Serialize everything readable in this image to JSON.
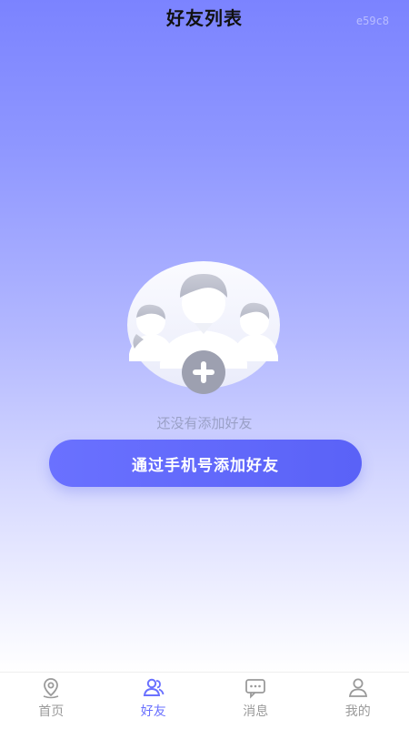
{
  "header": {
    "title": "好友列表",
    "watermark": "e59c8"
  },
  "empty_state": {
    "illustration_icon": "friends-group-add-icon",
    "message": "还没有添加好友",
    "button_label": "通过手机号添加好友"
  },
  "tabbar": {
    "items": [
      {
        "label": "首页",
        "icon": "location-pin-icon",
        "active": false
      },
      {
        "label": "好友",
        "icon": "friends-icon",
        "active": true
      },
      {
        "label": "消息",
        "icon": "message-icon",
        "active": false
      },
      {
        "label": "我的",
        "icon": "user-icon",
        "active": false
      }
    ]
  },
  "colors": {
    "accent": "#6a71ff",
    "gradient_top": "#7b83ff",
    "inactive_tab": "#9a9a9a"
  }
}
